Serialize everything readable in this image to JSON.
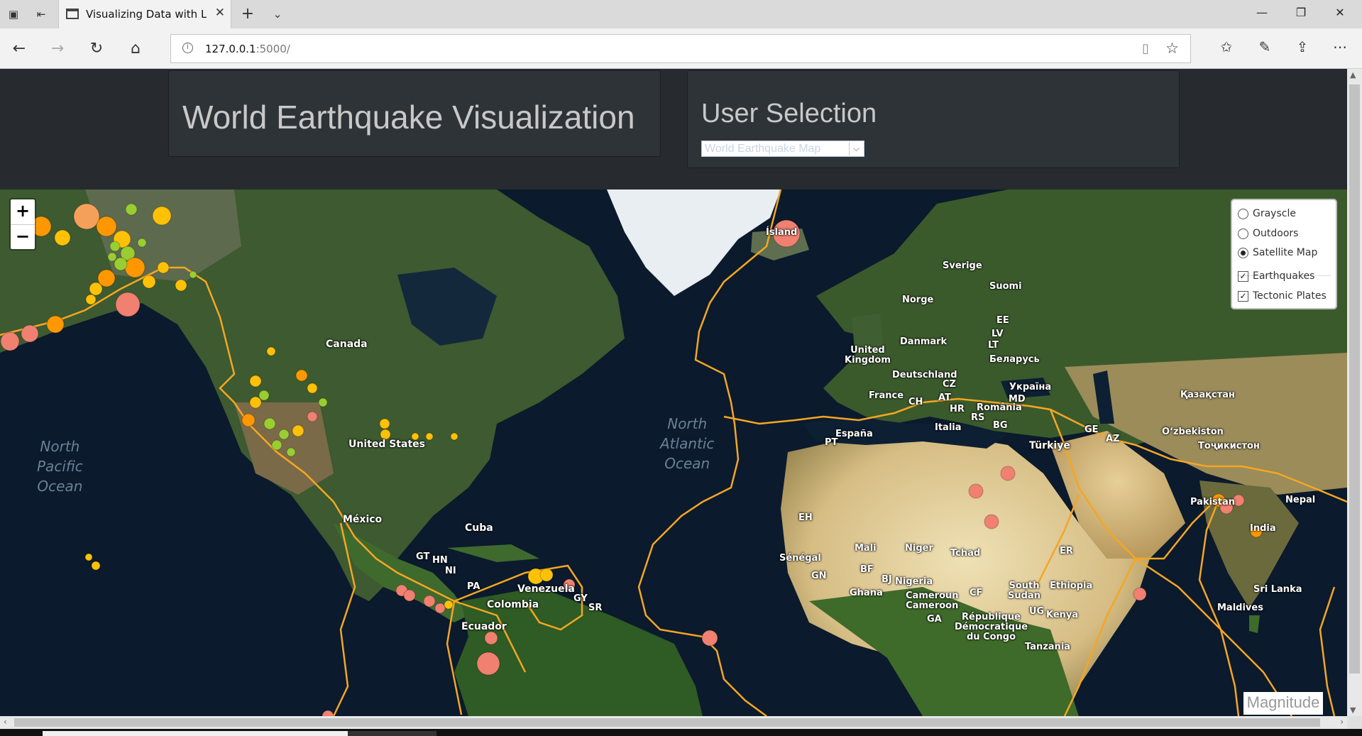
{
  "browser": {
    "tab_title": "Visualizing Data with Le",
    "url_host": "127.0.0.1",
    "url_port": ":5000/"
  },
  "header": {
    "title": "World Earthquake Visualization",
    "selection_title": "User Selection",
    "selection_value": "World Earthquake Map"
  },
  "map": {
    "zoom_in": "+",
    "zoom_out": "−",
    "base_layers": [
      {
        "label": "Grayscle",
        "selected": false
      },
      {
        "label": "Outdoors",
        "selected": false
      },
      {
        "label": "Satellite Map",
        "selected": true
      }
    ],
    "overlays": [
      {
        "label": "Earthquakes",
        "checked": true
      },
      {
        "label": "Tectonic Plates",
        "checked": true
      }
    ],
    "legend_title": "Magnitude",
    "ocean_labels": {
      "north_pacific": "North\nPacific\nOcean",
      "north_atlantic": "North\nAtlantic\nOcean"
    },
    "place_labels": {
      "canada": "Canada",
      "united_states": "United States",
      "mexico": "México",
      "cuba": "Cuba",
      "venezuela": "Venezuela",
      "colombia": "Colombia",
      "ecuador": "Ecuador",
      "gt": "GT",
      "hn": "HN",
      "ni": "NI",
      "pa": "PA",
      "gy": "GY",
      "sr": "SR",
      "island": "Ísland",
      "sverige": "Sverige",
      "suomi": "Suomi",
      "norge": "Norge",
      "danmark": "Danmark",
      "ee": "EE",
      "lv": "LV",
      "lt": "LT",
      "belarus": "Беларусь",
      "united_kingdom": "United\nKingdom",
      "deutschland": "Deutschland",
      "cz": "CZ",
      "ukraina": "Україна",
      "france": "France",
      "ch": "CH",
      "at": "AT",
      "md": "MD",
      "romania": "România",
      "hr": "HR",
      "rs": "RS",
      "italia": "Italia",
      "bg": "BG",
      "espana": "España",
      "pt": "PT",
      "turkiye": "Türkiye",
      "ge": "GE",
      "az": "AZ",
      "kazakhstan": "Қазақстан",
      "ozbekiston": "O‘zbekiston",
      "tojikiston": "Тоҷикистон",
      "pakistan": "Pakistan",
      "nepal": "Nepal",
      "india": "India",
      "sri_lanka": "Sri Lanka",
      "maldives": "Maldives",
      "eh": "EH",
      "mali": "Mali",
      "niger": "Niger",
      "tchad": "Tchad",
      "senegal": "Sénégal",
      "gn": "GN",
      "bf": "BF",
      "bj": "BJ",
      "nigeria": "Nigeria",
      "ghana": "Ghana",
      "cameroun": "Cameroun\nCameroon",
      "cf": "CF",
      "south_sudan": "South\nSudan",
      "ethiopia": "Ethiopia",
      "er": "ER",
      "ga": "GA",
      "republique": "République\nDémocratique\ndu Congo",
      "ug": "UG",
      "kenya": "Kenya",
      "tanzania": "Tanzania"
    }
  },
  "colors": {
    "page_bg": "#272b30",
    "panel_bg": "#2e3338",
    "plate_line": "#f5a623",
    "mag_low": "#9acd32",
    "mag_mid": "#ffc107",
    "mag_high": "#ff9800",
    "mag_top": "#f08070"
  }
}
